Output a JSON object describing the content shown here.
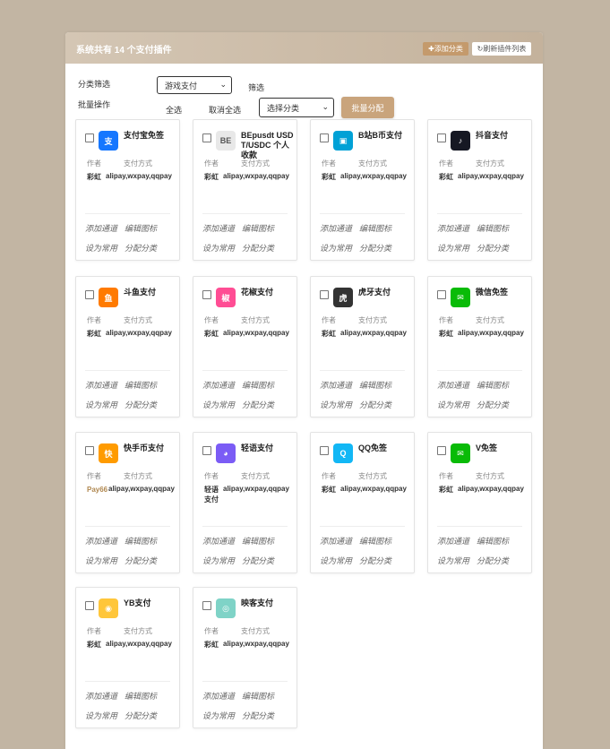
{
  "header": {
    "title": "系统共有 14 个支付插件",
    "add_label": "✚添加分类",
    "refresh_label": "↻刷新插件列表"
  },
  "filter": {
    "label": "分类筛选",
    "category_value": "游戏支付",
    "submit_label": "筛选"
  },
  "batch": {
    "label": "批量操作",
    "select_all": "全选",
    "deselect_all": "取消全选",
    "category_placeholder": "选择分类",
    "assign_label": "批量分配"
  },
  "card_labels": {
    "author": "作者",
    "pay_methods": "支付方式",
    "add_channel": "添加通道",
    "edit_icon": "编辑图标",
    "set_common": "设为常用",
    "assign_category": "分配分类"
  },
  "plugins": [
    {
      "name": "支付宝免签",
      "author": "彩虹",
      "pay": "alipay,wxpay,qqpay",
      "icon": "alipay-icon",
      "color": "#1677ff"
    },
    {
      "name": "BEpusdt USDT/USDC 个人收款",
      "author": "彩虹",
      "pay": "alipay,wxpay,qqpay",
      "icon": "bepusdt-icon",
      "color": "#e8e8e8"
    },
    {
      "name": "B站B币支付",
      "author": "彩虹",
      "pay": "alipay,wxpay,qqpay",
      "icon": "bilibili-icon",
      "color": "#00a1d6"
    },
    {
      "name": "抖音支付",
      "author": "彩虹",
      "pay": "alipay,wxpay,qqpay",
      "icon": "douyin-icon",
      "color": "#161823"
    },
    {
      "name": "斗鱼支付",
      "author": "彩虹",
      "pay": "alipay,wxpay,qqpay",
      "icon": "douyu-icon",
      "color": "#ff7a00"
    },
    {
      "name": "花椒支付",
      "author": "彩虹",
      "pay": "alipay,wxpay,qqpay",
      "icon": "huajiao-icon",
      "color": "#ff4d94"
    },
    {
      "name": "虎牙支付",
      "author": "彩虹",
      "pay": "alipay,wxpay,qqpay",
      "icon": "huya-icon",
      "color": "#333333"
    },
    {
      "name": "微信免签",
      "author": "彩虹",
      "pay": "alipay,wxpay,qqpay",
      "icon": "wechat-icon",
      "color": "#09bb07"
    },
    {
      "name": "快手币支付",
      "author": "Pay66",
      "pay": "alipay,wxpay,qqpay",
      "icon": "kuaishou-icon",
      "color": "#ff9b00"
    },
    {
      "name": "轻语支付",
      "author": "轻语支付",
      "pay": "alipay,wxpay,qqpay",
      "icon": "qingyu-icon",
      "color": "#7b5cf5"
    },
    {
      "name": "QQ免签",
      "author": "彩虹",
      "pay": "alipay,wxpay,qqpay",
      "icon": "qq-icon",
      "color": "#12b7f5"
    },
    {
      "name": "V免签",
      "author": "彩虹",
      "pay": "alipay,wxpay,qqpay",
      "icon": "wechat-icon",
      "color": "#09bb07"
    },
    {
      "name": "YB支付",
      "author": "彩虹",
      "pay": "alipay,wxpay,qqpay",
      "icon": "yb-raccoon-icon",
      "color": "#ffc63a"
    },
    {
      "name": "映客支付",
      "author": "彩虹",
      "pay": "alipay,wxpay,qqpay",
      "icon": "yingke-icon",
      "color": "#7fd3c7"
    }
  ]
}
